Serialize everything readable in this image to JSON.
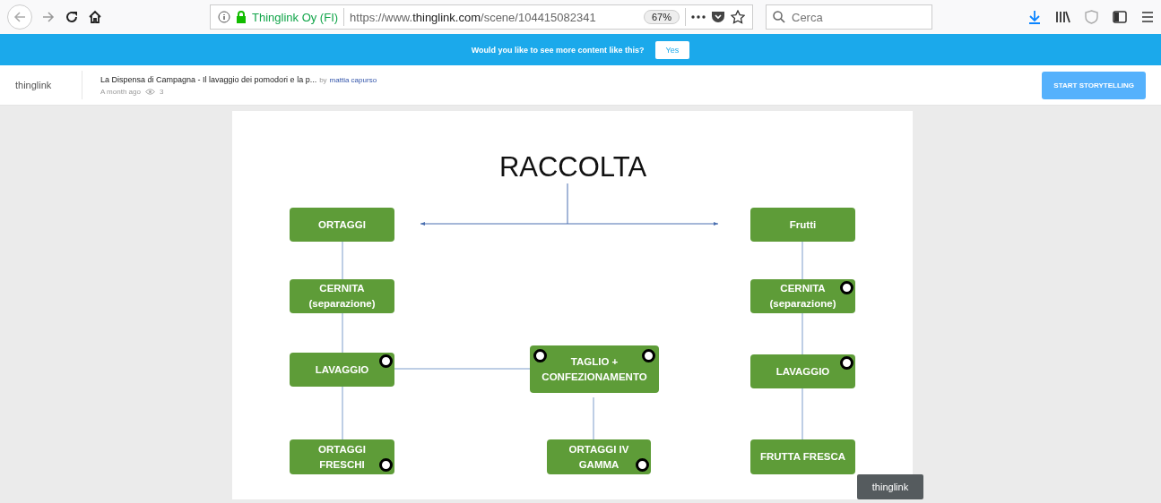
{
  "browser": {
    "identity": "Thinglink Oy (FI)",
    "url_prefix": "https://www.",
    "url_domain": "thinglink.com",
    "url_path": "/scene/104415082341",
    "zoom": "67%",
    "search": {
      "placeholder": "Cerca"
    }
  },
  "banner": {
    "text": "Would you like to see more content like this?",
    "button": "Yes"
  },
  "header": {
    "logo": "thinglink",
    "title": "La Dispensa di Campagna - Il lavaggio dei pomodori e la p...",
    "by": "by",
    "author": "mattia capurso",
    "time": "A month ago",
    "views": "3",
    "button": "START STORYTELLING"
  },
  "scene": {
    "title": "RACCOLTA",
    "badge": "thinglink",
    "nodes": [
      {
        "label": "ORTAGGI",
        "hotspot_left": false,
        "hotspot_right": false
      },
      {
        "label": "Frutti",
        "hotspot_left": false,
        "hotspot_right": false
      },
      {
        "label": "CERNITA\n(separazione)",
        "hotspot_left": false,
        "hotspot_right": false
      },
      {
        "label": "CERNITA\n(separazione)",
        "hotspot_left": false,
        "hotspot_right": true
      },
      {
        "label": "LAVAGGIO",
        "hotspot_left": false,
        "hotspot_right": true
      },
      {
        "label": "TAGLIO +\nCONFEZIONAMENTO",
        "hotspot_left": true,
        "hotspot_right": true
      },
      {
        "label": "LAVAGGIO",
        "hotspot_left": false,
        "hotspot_right": true
      },
      {
        "label": "ORTAGGI\nFRESCHI",
        "hotspot_left": false,
        "hotspot_right": true
      },
      {
        "label": "ORTAGGI IV\nGAMMA",
        "hotspot_left": false,
        "hotspot_right": true
      },
      {
        "label": "FRUTTA FRESCA",
        "hotspot_left": false,
        "hotspot_right": false
      }
    ]
  }
}
